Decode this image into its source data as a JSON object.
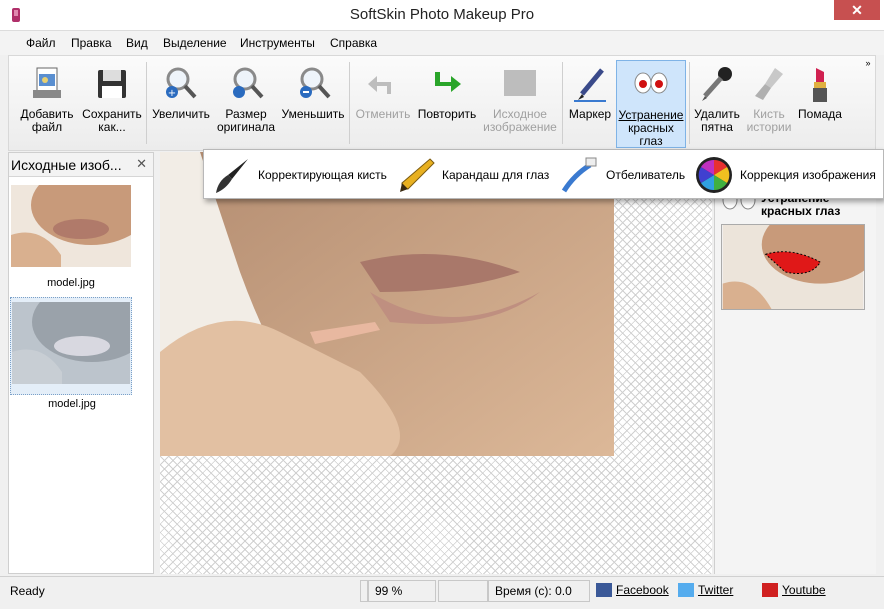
{
  "window": {
    "title": "SoftSkin Photo Makeup Pro",
    "close_glyph": "✕"
  },
  "menu": [
    "Файл",
    "Правка",
    "Вид",
    "Выделение",
    "Инструменты",
    "Справка"
  ],
  "toolbar": {
    "add_file": [
      "Добавить",
      "файл"
    ],
    "save_as": [
      "Сохранить",
      "как..."
    ],
    "zoom_in": [
      "Увеличить"
    ],
    "original_size": [
      "Размер",
      "оригинала"
    ],
    "zoom_out": [
      "Уменьшить"
    ],
    "undo": [
      "Отменить"
    ],
    "redo": [
      "Повторить"
    ],
    "source_image": [
      "Исходное",
      "изображение"
    ],
    "marker": [
      "Маркер"
    ],
    "red_eye": [
      "Устранение",
      "красных",
      "глаз"
    ],
    "remove_spots": [
      "Удалить",
      "пятна"
    ],
    "history_brush": [
      "Кисть",
      "истории"
    ],
    "lipstick": [
      "Помада"
    ],
    "more_glyph": "»"
  },
  "left_panel": {
    "title": "Исходные изоб...",
    "close_glyph": "✕",
    "thumbnails": [
      {
        "label": "model.jpg"
      },
      {
        "label": "model.jpg"
      }
    ]
  },
  "popup_tools": [
    {
      "label": "Корректирующая кисть",
      "icon": "brush-icon"
    },
    {
      "label": "Карандаш для глаз",
      "icon": "pencil-icon"
    },
    {
      "label": "Отбеливатель",
      "icon": "toothbrush-icon"
    },
    {
      "label": "Коррекция изображения",
      "icon": "color-wheel-icon"
    }
  ],
  "right_panel": {
    "tool_label": [
      "Устранение",
      "красных глаз"
    ]
  },
  "status": {
    "ready": "Ready",
    "zoom": "99 %",
    "time": "Время (с): 0.0",
    "facebook": "Facebook",
    "twitter": "Twitter",
    "youtube": "Youtube"
  }
}
